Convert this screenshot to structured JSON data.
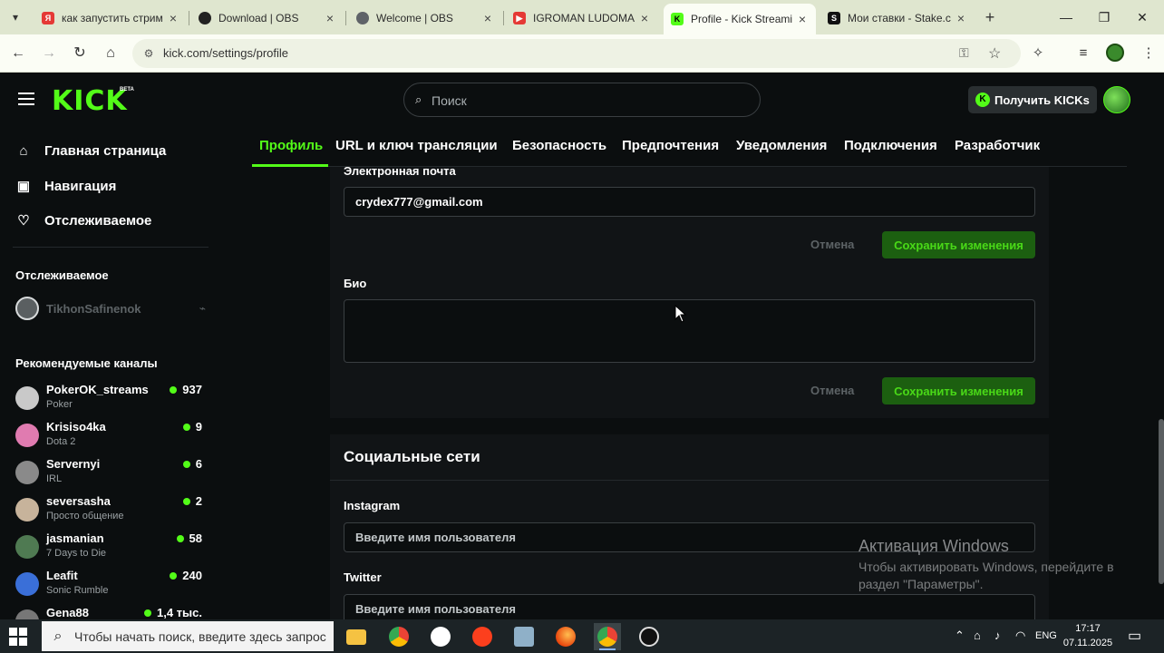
{
  "browser": {
    "tabs": [
      {
        "title": "как запустить стрим",
        "favicon_color": "#e53935",
        "favicon_glyph": "Я"
      },
      {
        "title": "Download | OBS",
        "favicon_color": "#222222",
        "favicon_glyph": "●"
      },
      {
        "title": "Welcome | OBS",
        "favicon_color": "#555555",
        "favicon_glyph": "◎"
      },
      {
        "title": "IGROMAN LUDOMAN",
        "favicon_color": "#e53935",
        "favicon_glyph": "▶"
      },
      {
        "title": "Profile - Kick Streaming",
        "favicon_color": "#53fc18",
        "favicon_glyph": "K"
      },
      {
        "title": "Мои ставки - Stake.com",
        "favicon_color": "#111111",
        "favicon_glyph": "S"
      }
    ],
    "active_tab_index": 4,
    "url": "kick.com/settings/profile"
  },
  "kick": {
    "search_placeholder": "Поиск",
    "get_kicks_label": "Получить KICKs",
    "brand_color": "#53fc18",
    "logo_text": "KICK",
    "logo_badge": "BETA",
    "sidebar": {
      "nav": [
        {
          "label": "Главная страница",
          "icon": "home-icon"
        },
        {
          "label": "Навигация",
          "icon": "browse-icon"
        },
        {
          "label": "Отслеживаемое",
          "icon": "heart-icon"
        }
      ],
      "following_heading": "Отслеживаемое",
      "following": [
        {
          "name": "TikhonSafinenok",
          "status": "offline"
        }
      ],
      "recommended_heading": "Рекомендуемые каналы",
      "recommended": [
        {
          "name": "PokerOK_streams",
          "category": "Poker",
          "viewers": "937",
          "avatar_color": "#c9c9c9"
        },
        {
          "name": "Krisiso4ka",
          "category": "Dota 2",
          "viewers": "9",
          "avatar_color": "#e07bb0"
        },
        {
          "name": "Servernyi",
          "category": "IRL",
          "viewers": "6",
          "avatar_color": "#8a8a8a"
        },
        {
          "name": "seversasha",
          "category": "Просто общение",
          "viewers": "2",
          "avatar_color": "#c7b39b"
        },
        {
          "name": "jasmanian",
          "category": "7 Days to Die",
          "viewers": "58",
          "avatar_color": "#4f7a52"
        },
        {
          "name": "Leafit",
          "category": "Sonic Rumble",
          "viewers": "240",
          "avatar_color": "#3a6fd8"
        },
        {
          "name": "Gena88",
          "category": "",
          "viewers": "1,4 тыс.",
          "avatar_color": "#777777"
        }
      ]
    },
    "settings_tabs": [
      "Профиль",
      "URL и ключ трансляции",
      "Безопасность",
      "Предпочтения",
      "Уведомления",
      "Подключения",
      "Разработчик"
    ],
    "profile": {
      "email_label": "Электронная почта",
      "email_value": "crydex777@gmail.com",
      "bio_label": "Био",
      "bio_value": "",
      "cancel_label": "Отмена",
      "save_label": "Сохранить изменения",
      "social_title": "Социальные сети",
      "instagram_label": "Instagram",
      "twitter_label": "Twitter",
      "username_placeholder": "Введите имя пользователя"
    }
  },
  "watermark": {
    "title": "Активация Windows",
    "subtitle": "Чтобы активировать Windows, перейдите в раздел \"Параметры\"."
  },
  "taskbar": {
    "search_placeholder": "Чтобы начать поиск, введите здесь запрос",
    "language": "ENG",
    "time": "17:17",
    "date": "07.11.2025"
  }
}
